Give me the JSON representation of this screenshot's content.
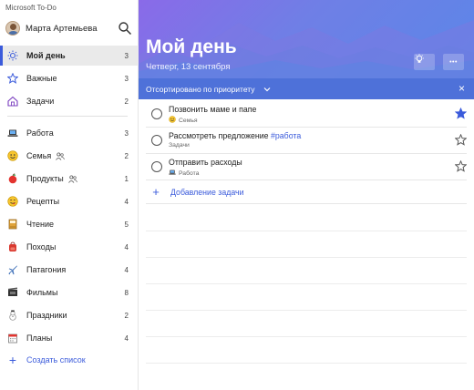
{
  "app": {
    "title": "Microsoft To-Do"
  },
  "user": {
    "name": "Марта Артемьева"
  },
  "sidebar": {
    "items": [
      {
        "label": "Мой день",
        "count": "3",
        "icon": "sun-icon"
      },
      {
        "label": "Важные",
        "count": "3",
        "icon": "star-icon"
      },
      {
        "label": "Задачи",
        "count": "2",
        "icon": "home-icon"
      },
      {
        "label": "Работа",
        "count": "3",
        "icon": "laptop-icon"
      },
      {
        "label": "Семья",
        "count": "2",
        "icon": "smiley-icon",
        "shared": true
      },
      {
        "label": "Продукты",
        "count": "1",
        "icon": "apple-icon",
        "shared": true
      },
      {
        "label": "Рецепты",
        "count": "4",
        "icon": "face-savoring-icon"
      },
      {
        "label": "Чтение",
        "count": "5",
        "icon": "book-icon"
      },
      {
        "label": "Походы",
        "count": "4",
        "icon": "backpack-icon"
      },
      {
        "label": "Патагония",
        "count": "4",
        "icon": "airplane-icon"
      },
      {
        "label": "Фильмы",
        "count": "8",
        "icon": "film-icon"
      },
      {
        "label": "Праздники",
        "count": "2",
        "icon": "snowman-icon"
      },
      {
        "label": "Планы",
        "count": "4",
        "icon": "calendar-icon"
      }
    ],
    "create_list": "Создать список"
  },
  "main": {
    "title": "Мой день",
    "date": "Четверг, 13 сентября",
    "sort_label": "Отсортировано по приоритету",
    "close": "×",
    "more": "•••",
    "tasks": [
      {
        "title": "Позвонить маме и папе",
        "tag": "",
        "list": "Семья",
        "list_icon": "smiley-icon",
        "important": true
      },
      {
        "title": "Рассмотреть предложение ",
        "tag": "#работа",
        "list": "Задачи",
        "list_icon": "",
        "important": false
      },
      {
        "title": "Отправить расходы",
        "tag": "",
        "list": "Работа",
        "list_icon": "laptop-icon",
        "important": false
      }
    ],
    "add_task": "Добавление задачи"
  },
  "colors": {
    "accent": "#3b5bdb",
    "sort_bar": "#4e71d9",
    "hero_start": "#8a6ae8",
    "hero_end": "#5b86e8"
  }
}
